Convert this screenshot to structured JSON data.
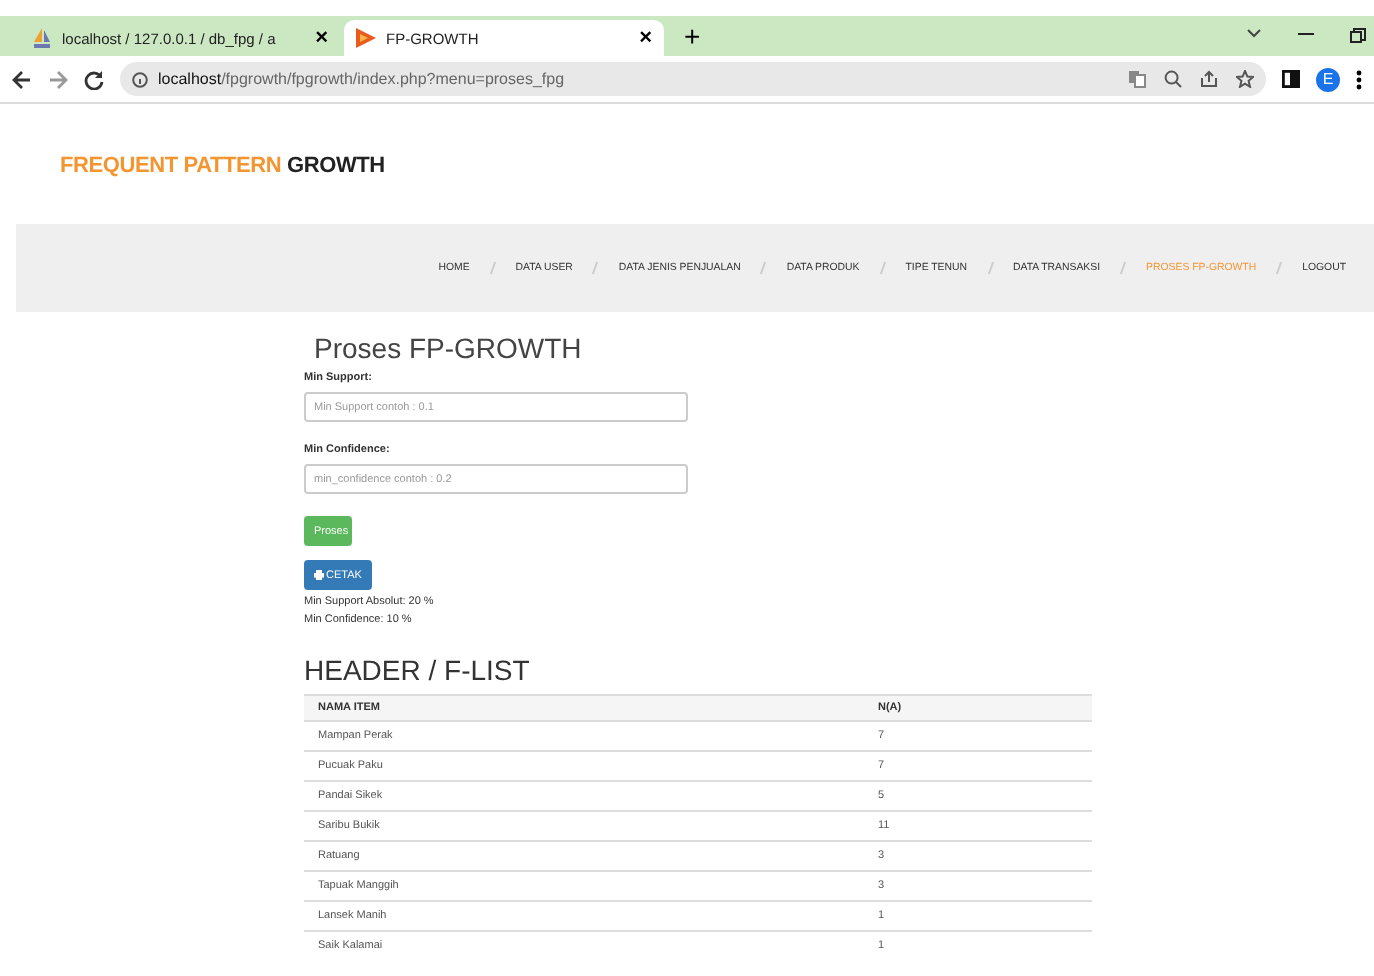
{
  "browser": {
    "tabs": [
      {
        "title": "localhost / 127.0.0.1 / db_fpg / a",
        "selected": false,
        "close": "×"
      },
      {
        "title": "FP-GROWTH",
        "selected": true,
        "close": "×"
      }
    ],
    "new_tab": "+",
    "url_host": "localhost",
    "url_path": "/fpgrowth/fpgrowth/index.php?menu=proses_fpg",
    "profile": "E"
  },
  "site": {
    "title_accent": "FREQUENT PATTERN",
    "title_rest": "GROWTH"
  },
  "nav": [
    {
      "label": "HOME",
      "selected": false
    },
    {
      "label": "DATA USER",
      "selected": false
    },
    {
      "label": "DATA JENIS PENJUALAN",
      "selected": false
    },
    {
      "label": "DATA PRODUK",
      "selected": false
    },
    {
      "label": "TIPE TENUN",
      "selected": false
    },
    {
      "label": "DATA TRANSAKSI",
      "selected": false
    },
    {
      "label": "PROSES FP-GROWTH",
      "selected": true
    },
    {
      "label": "LOGOUT",
      "selected": false
    }
  ],
  "form": {
    "heading": "Proses FP-GROWTH",
    "fields": [
      {
        "label": "Min Support:",
        "placeholder": "Min Support contoh : 0.1"
      },
      {
        "label": "Min Confidence:",
        "placeholder": "min_confidence contoh : 0.2"
      }
    ],
    "submit": "Proses",
    "print": "CETAK",
    "results": [
      "Min Support Absolut: 20 %",
      "Min Confidence: 10 %"
    ]
  },
  "flist": {
    "heading": "HEADER / F-LIST",
    "columns": [
      "NAMA ITEM",
      "N(A)"
    ],
    "rows": [
      [
        "Mampan Perak",
        "7"
      ],
      [
        "Pucuak Paku",
        "7"
      ],
      [
        "Pandai Sikek",
        "5"
      ],
      [
        "Saribu Bukik",
        "11"
      ],
      [
        "Ratuang",
        "3"
      ],
      [
        "Tapuak Manggih",
        "3"
      ],
      [
        "Lansek Manih",
        "1"
      ],
      [
        "Saik Kalamai",
        "1"
      ]
    ]
  }
}
